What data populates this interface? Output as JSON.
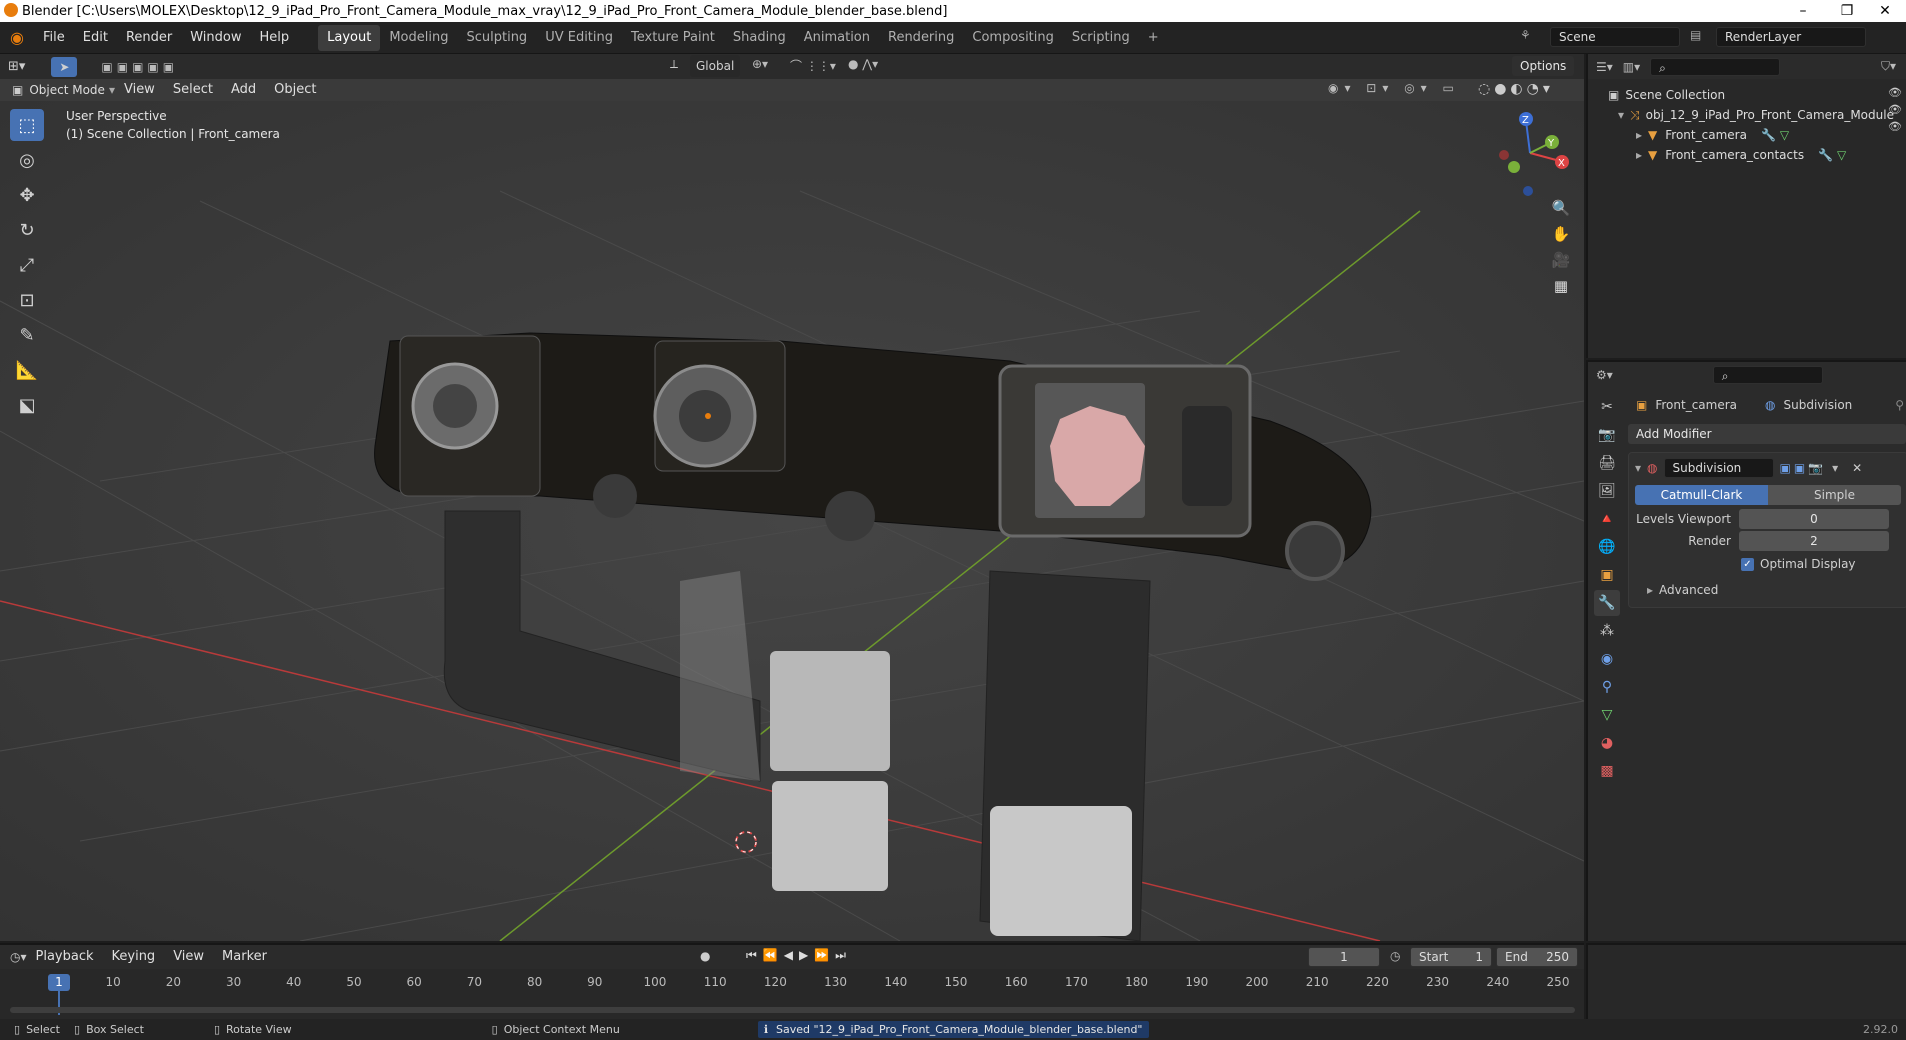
{
  "window": {
    "title": "Blender [C:\\Users\\MOLEX\\Desktop\\12_9_iPad_Pro_Front_Camera_Module_max_vray\\12_9_iPad_Pro_Front_Camera_Module_blender_base.blend]",
    "minimize": "–",
    "maximize": "❐",
    "close": "✕"
  },
  "menubar": {
    "items": [
      "File",
      "Edit",
      "Render",
      "Window",
      "Help"
    ]
  },
  "workspaces": {
    "tabs": [
      "Layout",
      "Modeling",
      "Sculpting",
      "UV Editing",
      "Texture Paint",
      "Shading",
      "Animation",
      "Rendering",
      "Compositing",
      "Scripting"
    ],
    "add": "+",
    "active": "Layout"
  },
  "scene": {
    "name": "Scene",
    "view_layer": "RenderLayer"
  },
  "viewport_header": {
    "mode": "Object Mode",
    "menus": [
      "View",
      "Select",
      "Add",
      "Object"
    ],
    "orientation": "Global",
    "options": "Options"
  },
  "viewport": {
    "perspective": "User Perspective",
    "collection_info": "(1) Scene Collection | Front_camera",
    "gizmo": {
      "z": "Z",
      "y": "Y",
      "x": "X"
    }
  },
  "outliner": {
    "root": "Scene Collection",
    "collection": "obj_12_9_iPad_Pro_Front_Camera_Module",
    "objects": [
      "Front_camera",
      "Front_camera_contacts"
    ]
  },
  "properties": {
    "object_name": "Front_camera",
    "modifier_context": "Subdivision",
    "add_modifier": "Add Modifier",
    "modifier": {
      "name": "Subdivision",
      "type_a": "Catmull-Clark",
      "type_b": "Simple",
      "levels_viewport_label": "Levels Viewport",
      "levels_viewport": "0",
      "render_label": "Render",
      "render": "2",
      "optimal_display": "Optimal Display",
      "advanced": "Advanced"
    }
  },
  "timeline": {
    "menus": [
      "Playback",
      "Keying",
      "View",
      "Marker"
    ],
    "current_frame": "1",
    "start_label": "Start",
    "start": "1",
    "end_label": "End",
    "end": "250",
    "ticks": [
      "1",
      "10",
      "20",
      "30",
      "40",
      "50",
      "60",
      "70",
      "80",
      "90",
      "100",
      "110",
      "120",
      "130",
      "140",
      "150",
      "160",
      "170",
      "180",
      "190",
      "200",
      "210",
      "220",
      "230",
      "240",
      "250"
    ]
  },
  "statusbar": {
    "select": "Select",
    "box_select": "Box Select",
    "rotate_view": "Rotate View",
    "context_menu": "Object Context Menu",
    "message": "Saved \"12_9_iPad_Pro_Front_Camera_Module_blender_base.blend\"",
    "version": "2.92.0"
  },
  "colors": {
    "accent": "#4772b3",
    "x_axis": "#c83c3c",
    "y_axis": "#6a9a2a",
    "brand": "#e87d0d"
  }
}
